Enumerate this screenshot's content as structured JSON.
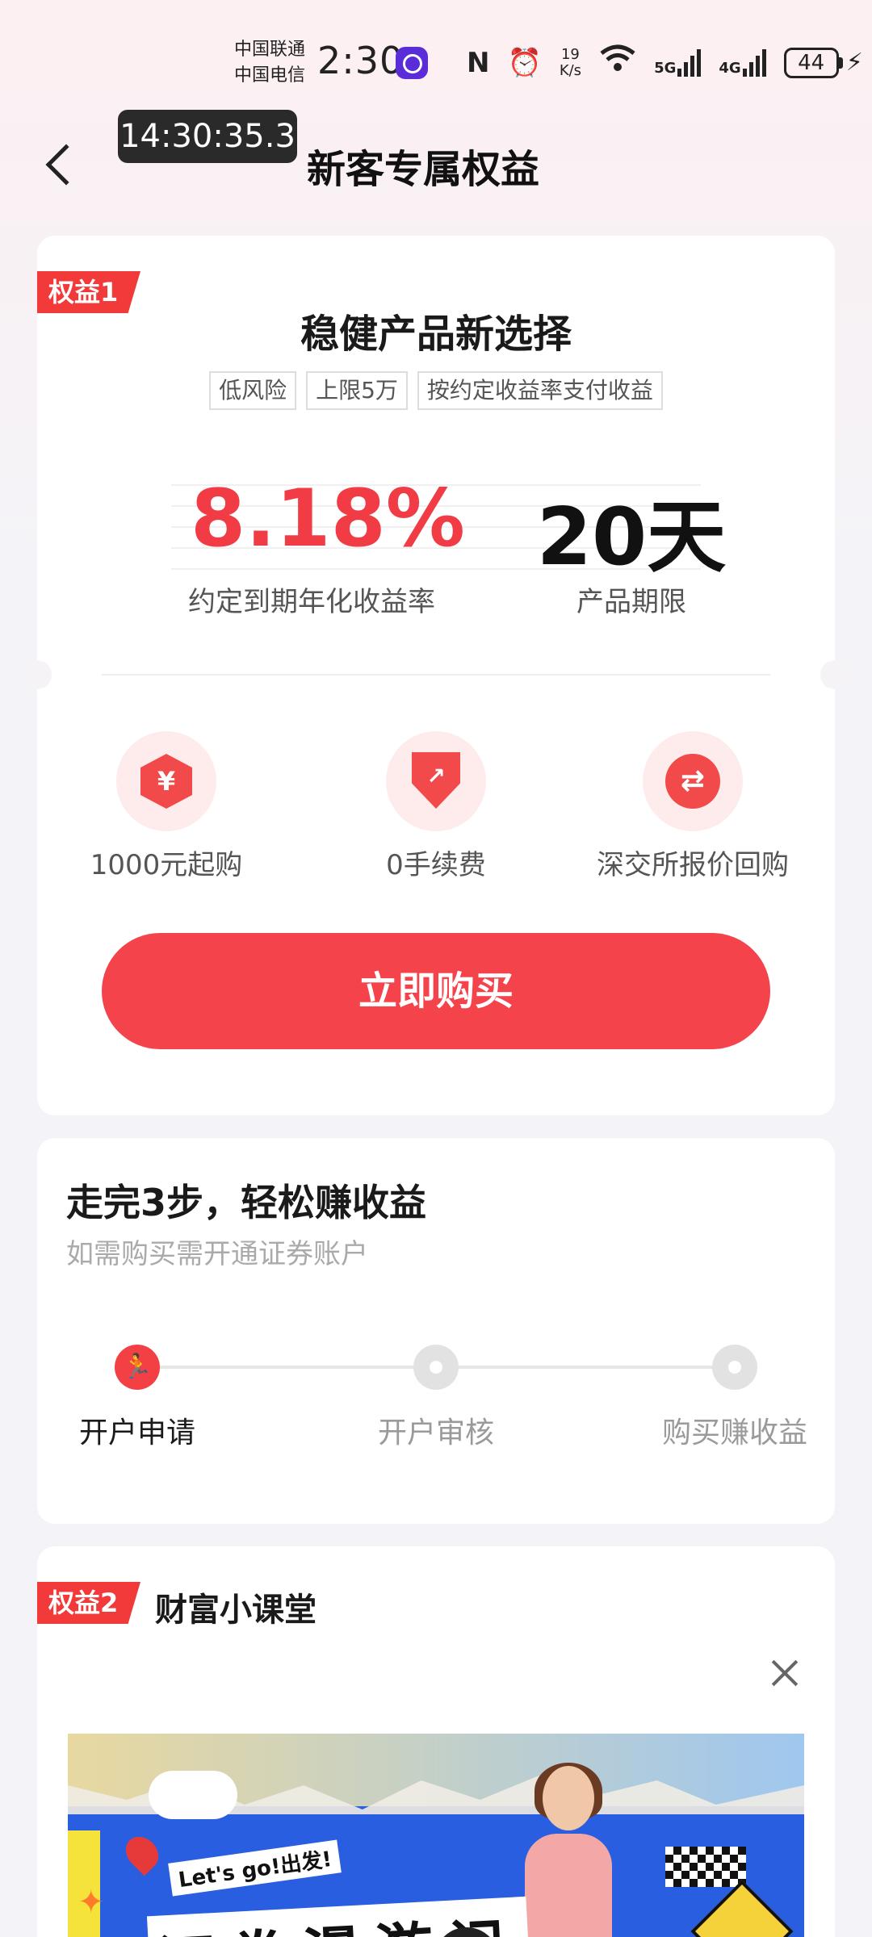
{
  "status_bar": {
    "carrier_1": "中国联通",
    "carrier_2": "中国电信",
    "time": "2:30",
    "nfc_icon": "N",
    "alarm_icon": "⏰",
    "speed_value": "19",
    "speed_unit": "K/s",
    "wifi_icon": "wifi",
    "net_5g": "5G",
    "net_4g": "4G",
    "battery": "44",
    "charging_icon": "⚡"
  },
  "nav": {
    "back_icon": "chevron-left",
    "time_overlay": "14:30:35.3",
    "title": "新客专属权益"
  },
  "benefit1": {
    "tag": "权益1",
    "product_title": "稳健产品新选择",
    "chips": [
      "低风险",
      "上限5万",
      "按约定收益率支付收益"
    ],
    "rate_value": "8.18%",
    "rate_label": "约定到期年化收益率",
    "term_value": "20天",
    "term_label": "产品期限",
    "features": [
      {
        "icon": "yen-icon",
        "glyph": "¥",
        "label": "1000元起购"
      },
      {
        "icon": "shield-trend-icon",
        "glyph": "↗",
        "label": "0手续费"
      },
      {
        "icon": "cycle-icon",
        "glyph": "⇄",
        "label": "深交所报价回购"
      }
    ],
    "buy_button": "立即购买"
  },
  "steps": {
    "title": "走完3步，轻松赚收益",
    "subtitle": "如需购买需开通证券账户",
    "active_icon_glyph": "🏃",
    "items": [
      {
        "label": "开户申请",
        "active": true
      },
      {
        "label": "开户审核",
        "active": false
      },
      {
        "label": "购买赚收益",
        "active": false
      }
    ]
  },
  "benefit2": {
    "tag": "权益2",
    "title": "财富小课堂",
    "close_icon": "close",
    "banner": {
      "badge": "Let's go!出发!",
      "headline": "证券漫游记",
      "play_icon": "play"
    }
  },
  "colors": {
    "accent": "#f23c45",
    "button": "#f5434b",
    "tag": "#f23a3a"
  }
}
